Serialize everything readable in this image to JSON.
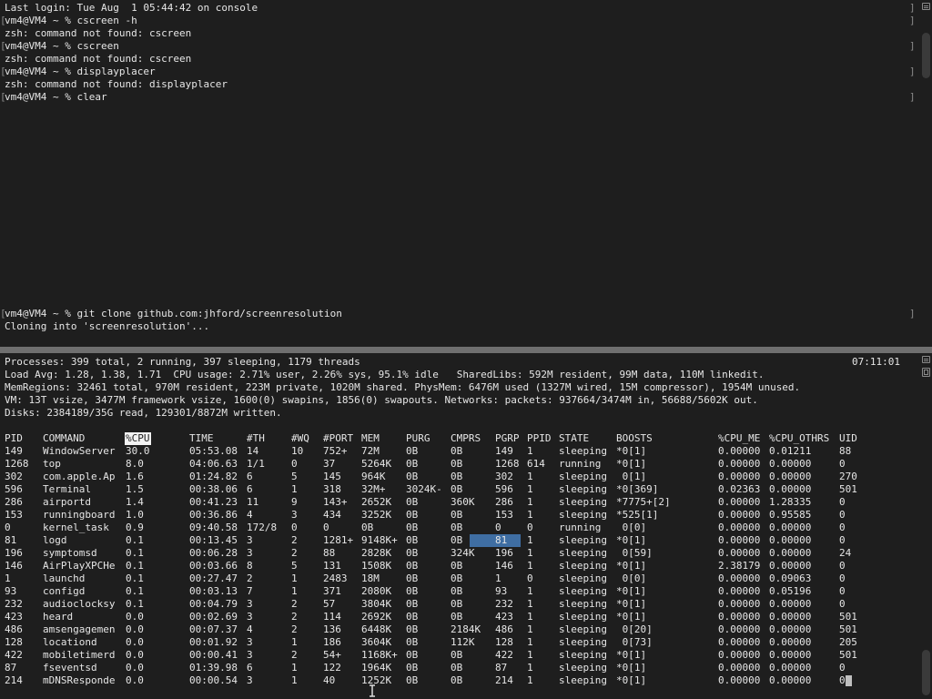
{
  "top_pane": {
    "lines": [
      "Last login: Tue Aug  1 05:44:42 on console",
      "vm4@VM4 ~ % cscreen -h",
      "zsh: command not found: cscreen",
      "vm4@VM4 ~ % cscreen",
      "zsh: command not found: cscreen",
      "vm4@VM4 ~ % displayplacer",
      "zsh: command not found: displayplacer",
      "vm4@VM4 ~ % clear"
    ],
    "lines2": [
      "vm4@VM4 ~ % git clone github.com:jhford/screenresolution",
      "Cloning into 'screenresolution'..."
    ]
  },
  "bottom_pane": {
    "summary": [
      "Processes: 399 total, 2 running, 397 sleeping, 1179 threads",
      "Load Avg: 1.28, 1.38, 1.71  CPU usage: 2.71% user, 2.26% sys, 95.1% idle   SharedLibs: 592M resident, 99M data, 110M linkedit.",
      "MemRegions: 32461 total, 970M resident, 223M private, 1020M shared. PhysMem: 6476M used (1327M wired, 15M compressor), 1954M unused.",
      "VM: 13T vsize, 3477M framework vsize, 1600(0) swapins, 1856(0) swapouts. Networks: packets: 937664/3474M in, 56688/5602K out.",
      "Disks: 2384189/35G read, 129301/8872M written."
    ],
    "clock": "07:11:01",
    "columns": [
      "PID",
      "COMMAND",
      "%CPU",
      "TIME",
      "#TH",
      "#WQ",
      "#PORT",
      "MEM",
      "PURG",
      "CMPRS",
      "PGRP",
      "PPID",
      "STATE",
      "BOOSTS",
      "%CPU_ME",
      "%CPU_OTHRS",
      "UID"
    ],
    "rows": [
      [
        "149",
        "WindowServer",
        "30.0",
        "05:53.08",
        "14",
        "10",
        "752+",
        "72M",
        "0B",
        "0B",
        "149",
        "1",
        "sleeping",
        "*0[1]",
        "0.00000",
        "0.01211",
        "88"
      ],
      [
        "1268",
        "top",
        "8.0",
        "04:06.63",
        "1/1",
        "0",
        "37",
        "5264K",
        "0B",
        "0B",
        "1268",
        "614",
        "running",
        "*0[1]",
        "0.00000",
        "0.00000",
        "0"
      ],
      [
        "302",
        "com.apple.Ap",
        "1.6",
        "01:24.82",
        "6",
        "5",
        "145",
        "964K",
        "0B",
        "0B",
        "302",
        "1",
        "sleeping",
        " 0[1]",
        "0.00000",
        "0.00000",
        "270"
      ],
      [
        "596",
        "Terminal",
        "1.5",
        "00:38.06",
        "6",
        "1",
        "318",
        "32M+",
        "3024K-",
        "0B",
        "596",
        "1",
        "sleeping",
        "*0[369]",
        "0.02363",
        "0.00000",
        "501"
      ],
      [
        "286",
        "airportd",
        "1.4",
        "00:41.23",
        "11",
        "9",
        "143+",
        "2652K",
        "0B",
        "360K",
        "286",
        "1",
        "sleeping",
        "*7775+[2]",
        "0.00000",
        "1.28335",
        "0"
      ],
      [
        "153",
        "runningboard",
        "1.0",
        "00:36.86",
        "4",
        "3",
        "434",
        "3252K",
        "0B",
        "0B",
        "153",
        "1",
        "sleeping",
        "*525[1]",
        "0.00000",
        "0.95585",
        "0"
      ],
      [
        "0",
        "kernel_task",
        "0.9",
        "09:40.58",
        "172/8",
        "0",
        "0",
        "0B",
        "0B",
        "0B",
        "0",
        "0",
        "running",
        " 0[0]",
        "0.00000",
        "0.00000",
        "0"
      ],
      [
        "81",
        "logd",
        "0.1",
        "00:13.45",
        "3",
        "2",
        "1281+",
        "9148K+",
        "0B",
        "0B",
        "81",
        "1",
        "sleeping",
        "*0[1]",
        "0.00000",
        "0.00000",
        "0"
      ],
      [
        "196",
        "symptomsd",
        "0.1",
        "00:06.28",
        "3",
        "2",
        "88",
        "2828K",
        "0B",
        "324K",
        "196",
        "1",
        "sleeping",
        " 0[59]",
        "0.00000",
        "0.00000",
        "24"
      ],
      [
        "146",
        "AirPlayXPCHe",
        "0.1",
        "00:03.66",
        "8",
        "5",
        "131",
        "1508K",
        "0B",
        "0B",
        "146",
        "1",
        "sleeping",
        "*0[1]",
        "2.38179",
        "0.00000",
        "0"
      ],
      [
        "1",
        "launchd",
        "0.1",
        "00:27.47",
        "2",
        "1",
        "2483",
        "18M",
        "0B",
        "0B",
        "1",
        "0",
        "sleeping",
        " 0[0]",
        "0.00000",
        "0.09063",
        "0"
      ],
      [
        "93",
        "configd",
        "0.1",
        "00:03.13",
        "7",
        "1",
        "371",
        "2080K",
        "0B",
        "0B",
        "93",
        "1",
        "sleeping",
        "*0[1]",
        "0.00000",
        "0.05196",
        "0"
      ],
      [
        "232",
        "audioclocksy",
        "0.1",
        "00:04.79",
        "3",
        "2",
        "57",
        "3804K",
        "0B",
        "0B",
        "232",
        "1",
        "sleeping",
        "*0[1]",
        "0.00000",
        "0.00000",
        "0"
      ],
      [
        "423",
        "heard",
        "0.0",
        "00:02.69",
        "3",
        "2",
        "114",
        "2692K",
        "0B",
        "0B",
        "423",
        "1",
        "sleeping",
        "*0[1]",
        "0.00000",
        "0.00000",
        "501"
      ],
      [
        "486",
        "amsengagemen",
        "0.0",
        "00:07.37",
        "4",
        "2",
        "136",
        "6448K",
        "0B",
        "2184K",
        "486",
        "1",
        "sleeping",
        " 0[20]",
        "0.00000",
        "0.00000",
        "501"
      ],
      [
        "128",
        "locationd",
        "0.0",
        "00:01.92",
        "3",
        "1",
        "186",
        "3604K",
        "0B",
        "112K",
        "128",
        "1",
        "sleeping",
        " 0[73]",
        "0.00000",
        "0.00000",
        "205"
      ],
      [
        "422",
        "mobiletimerd",
        "0.0",
        "00:00.41",
        "3",
        "2",
        "54+",
        "1168K+",
        "0B",
        "0B",
        "422",
        "1",
        "sleeping",
        "*0[1]",
        "0.00000",
        "0.00000",
        "501"
      ],
      [
        "87",
        "fseventsd",
        "0.0",
        "01:39.98",
        "6",
        "1",
        "122",
        "1964K",
        "0B",
        "0B",
        "87",
        "1",
        "sleeping",
        "*0[1]",
        "0.00000",
        "0.00000",
        "0"
      ],
      [
        "214",
        "mDNSResponde",
        "0.0",
        "00:00.54",
        "3",
        "1",
        "40",
        "1252K",
        "0B",
        "0B",
        "214",
        "1",
        "sleeping",
        "*0[1]",
        "0.00000",
        "0.00000",
        "0"
      ]
    ]
  },
  "icons": {
    "pane_controls": "split-pane-icon",
    "mouse": "ibeam-cursor-icon"
  }
}
